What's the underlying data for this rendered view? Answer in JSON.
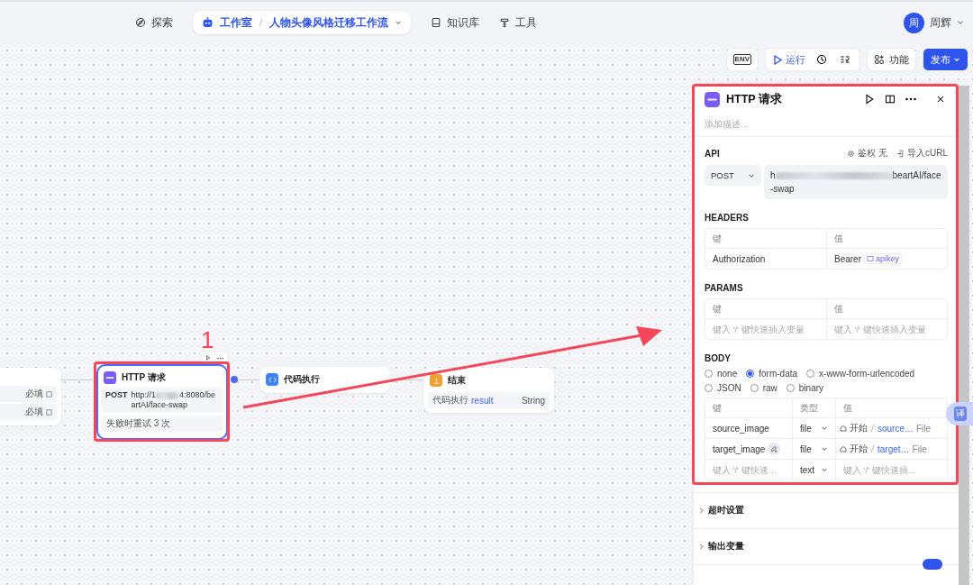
{
  "nav": {
    "items": [
      {
        "kind": "link",
        "label": "探索",
        "selected": false
      },
      {
        "kind": "workspace",
        "label": "工作室",
        "project": "人物头像风格迁移工作流",
        "selected": true
      },
      {
        "kind": "link",
        "label": "知识库",
        "selected": false
      },
      {
        "kind": "link",
        "label": "工具",
        "selected": false
      }
    ],
    "user": {
      "avatar": "周",
      "name": "周辉"
    }
  },
  "toolbar": {
    "env": "ENV",
    "run": "运行",
    "features": "功能",
    "publish": "发布"
  },
  "canvas": {
    "partial_node": {
      "rows": [
        "必填",
        "必填"
      ]
    },
    "http_node": {
      "title": "HTTP 请求",
      "method": "POST",
      "url_start": "http://1",
      "url_end": "4:8080/beartAI/face-swap",
      "footer": "失败时重试 3 次",
      "selected": true
    },
    "code_node": {
      "title": "代码执行"
    },
    "end_node": {
      "title": "结束",
      "source": "代码执行",
      "variable": "result",
      "type": "String"
    }
  },
  "annotation": {
    "label": "1"
  },
  "panel": {
    "title": "HTTP 请求",
    "description_placeholder": "添加描述...",
    "api": {
      "label": "API",
      "auth": "鉴权 无",
      "import": "导入cURL",
      "method": "POST",
      "url_start": "h",
      "url_end": "beartAI/face-swap"
    },
    "headers": {
      "label": "HEADERS",
      "columns": [
        "键",
        "值"
      ],
      "rows": [
        {
          "key": "Authorization",
          "value": "Bearer",
          "variable": "apikey"
        }
      ]
    },
    "params": {
      "label": "PARAMS",
      "columns": [
        "键",
        "值"
      ],
      "rows": [
        {
          "key_placeholder": "键入 '/' 键快速插入变量",
          "value_placeholder": "键入 '/' 键快速插入变量"
        }
      ]
    },
    "body": {
      "label": "BODY",
      "types": [
        {
          "label": "none",
          "selected": false
        },
        {
          "label": "form-data",
          "selected": true
        },
        {
          "label": "x-www-form-urlencoded",
          "selected": false
        },
        {
          "label": "JSON",
          "selected": false
        },
        {
          "label": "raw",
          "selected": false
        },
        {
          "label": "binary",
          "selected": false
        }
      ],
      "columns": [
        "键",
        "类型",
        "值"
      ],
      "rows": [
        {
          "key": "source_image",
          "edit_badge": false,
          "type": "file",
          "source": "开始",
          "variable": "source…",
          "value_type": "File"
        },
        {
          "key": "target_image",
          "edit_badge": true,
          "type": "file",
          "source": "开始",
          "variable": "target…",
          "value_type": "File"
        },
        {
          "key_placeholder": "键入 '/' 键快速…",
          "type": "text",
          "value_placeholder": "键入 '/' 键快速插…"
        }
      ]
    },
    "sections": [
      {
        "label": "超时设置",
        "expanded": false
      },
      {
        "label": "输出变量",
        "expanded": false
      }
    ],
    "footer_toggle": {
      "on": true
    }
  },
  "translate_button": "译"
}
